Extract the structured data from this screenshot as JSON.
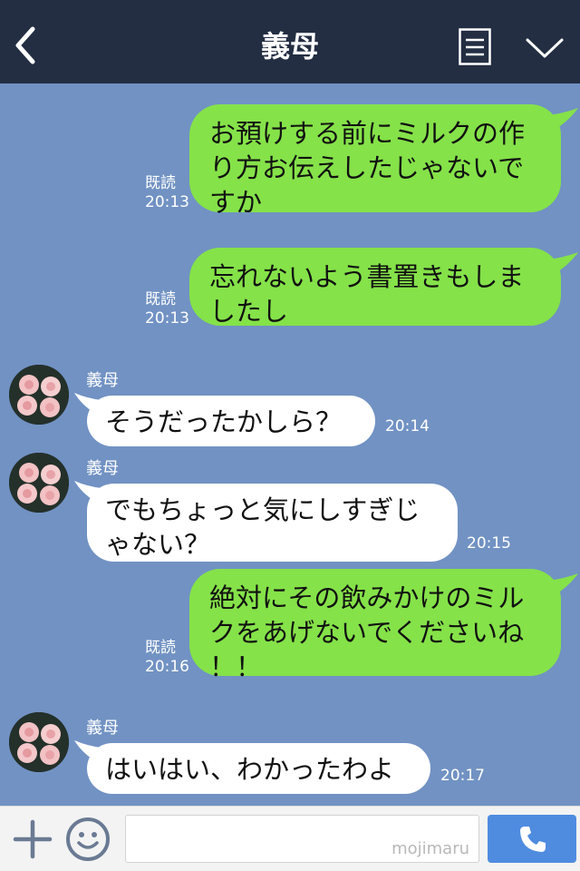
{
  "header": {
    "title": "義母"
  },
  "messages": [
    {
      "side": "out",
      "lines": [
        "お預けする前にミルクの作",
        "り方お伝えしたじゃないで",
        "すか"
      ],
      "read": "既読",
      "time": "20:13"
    },
    {
      "side": "out",
      "lines": [
        "忘れないよう書置きもしま",
        "したし"
      ],
      "read": "既読",
      "time": "20:13"
    },
    {
      "side": "in",
      "sender": "義母",
      "lines": [
        "そうだったかしら？"
      ],
      "time": "20:14"
    },
    {
      "side": "in",
      "sender": "義母",
      "lines": [
        "でもちょっと気にしすぎじ",
        "ゃない？"
      ],
      "time": "20:15"
    },
    {
      "side": "out",
      "lines": [
        "絶対にその飲みかけのミル",
        "クをあげないでくださいね",
        "！！"
      ],
      "read": "既読",
      "time": "20:16"
    },
    {
      "side": "in",
      "sender": "義母",
      "lines": [
        "はいはい、わかったわよ"
      ],
      "time": "20:17"
    }
  ],
  "input": {
    "watermark": "mojimaru"
  },
  "icons": {
    "back": "chevron-left-icon",
    "menu": "list-icon",
    "collapse": "chevron-down-icon",
    "add": "plus-icon",
    "emoji": "smiley-icon",
    "call": "phone-icon"
  },
  "colors": {
    "header": "#232e42",
    "background": "#7192c3",
    "outgoing_bubble": "#85e249",
    "incoming_bubble": "#ffffff",
    "call_button": "#4f8ce0"
  }
}
